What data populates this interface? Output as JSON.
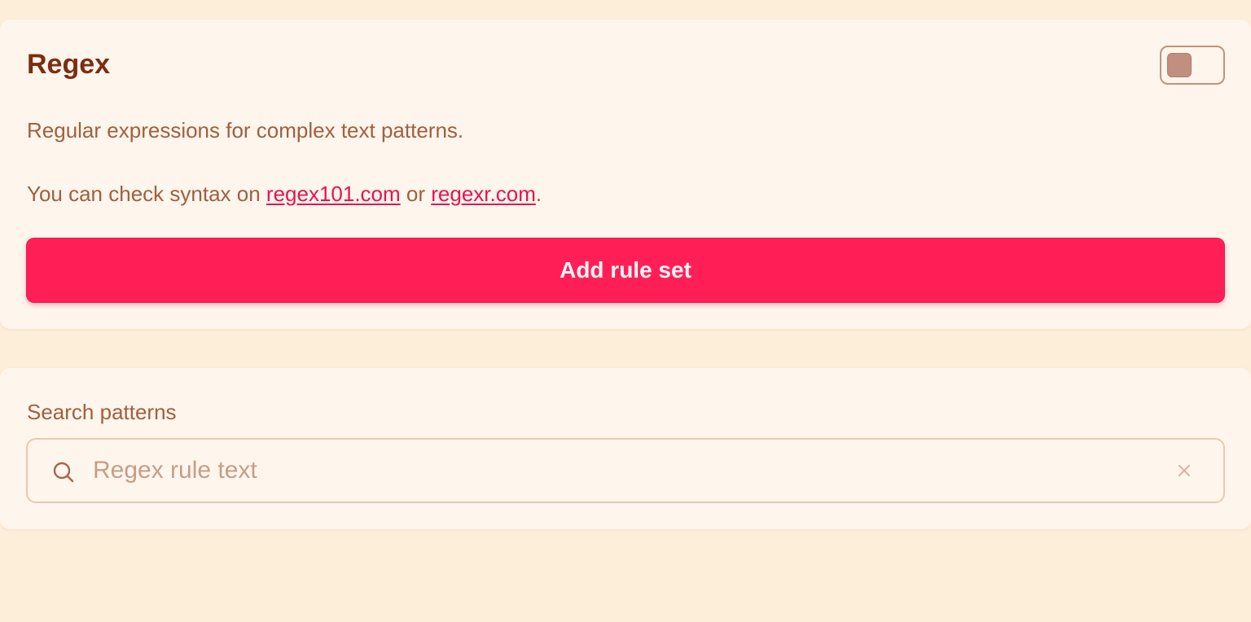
{
  "regex_card": {
    "title": "Regex",
    "toggle_icon": "toggle-switch-off",
    "description": "Regular expressions for complex text patterns.",
    "syntax_prefix": "You can check syntax on ",
    "link_1": "regex101.com",
    "syntax_middle": " or ",
    "link_2": "regexr.com",
    "syntax_suffix": ".",
    "add_button_label": "Add rule set"
  },
  "search_card": {
    "label": "Search patterns",
    "placeholder": "Regex rule text",
    "value": "",
    "search_icon": "magnifier-icon",
    "clear_icon": "close-icon"
  },
  "colors": {
    "background": "#fdeeda",
    "card": "#fef5ec",
    "title": "#7c2d12",
    "text": "#a0603f",
    "accent": "#ff1f56",
    "link": "#e8134f",
    "placeholder": "#c69e88"
  }
}
